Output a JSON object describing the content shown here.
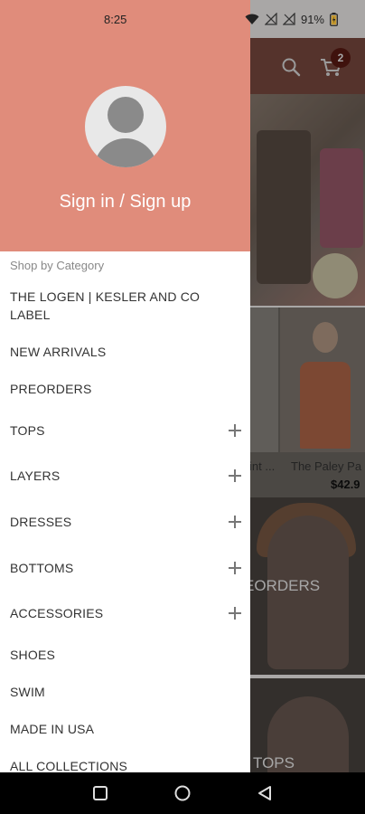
{
  "status_bar": {
    "time": "8:25",
    "battery": "91%"
  },
  "drawer": {
    "sign_in_label": "Sign in / Sign up",
    "section_label": "Shop by Category",
    "items": [
      {
        "label": "THE LOGEN | KESLER AND CO LABEL",
        "expandable": false
      },
      {
        "label": "NEW ARRIVALS",
        "expandable": false
      },
      {
        "label": "PREORDERS",
        "expandable": false
      },
      {
        "label": "TOPS",
        "expandable": true
      },
      {
        "label": "LAYERS",
        "expandable": true
      },
      {
        "label": "DRESSES",
        "expandable": true
      },
      {
        "label": "BOTTOMS",
        "expandable": true
      },
      {
        "label": "ACCESSORIES",
        "expandable": true
      },
      {
        "label": "SHOES",
        "expandable": false
      },
      {
        "label": "SWIM",
        "expandable": false
      },
      {
        "label": "MADE IN USA",
        "expandable": false
      },
      {
        "label": "ALL COLLECTIONS",
        "expandable": false
      }
    ]
  },
  "background": {
    "cart_count": "2",
    "product1_name": "int ...",
    "product2_name": "The Paley Pa",
    "product2_price": "$42.9",
    "tile1_label": "EORDERS",
    "tile2_label": "TOPS"
  },
  "colors": {
    "drawer_header": "#e08c7b",
    "app_header": "#7a4a40"
  },
  "icons": [
    "wifi-icon",
    "signal-icon",
    "battery-icon",
    "avatar-icon",
    "plus-icon",
    "search-icon",
    "cart-icon",
    "nav-recents-icon",
    "nav-home-icon",
    "nav-back-icon"
  ]
}
